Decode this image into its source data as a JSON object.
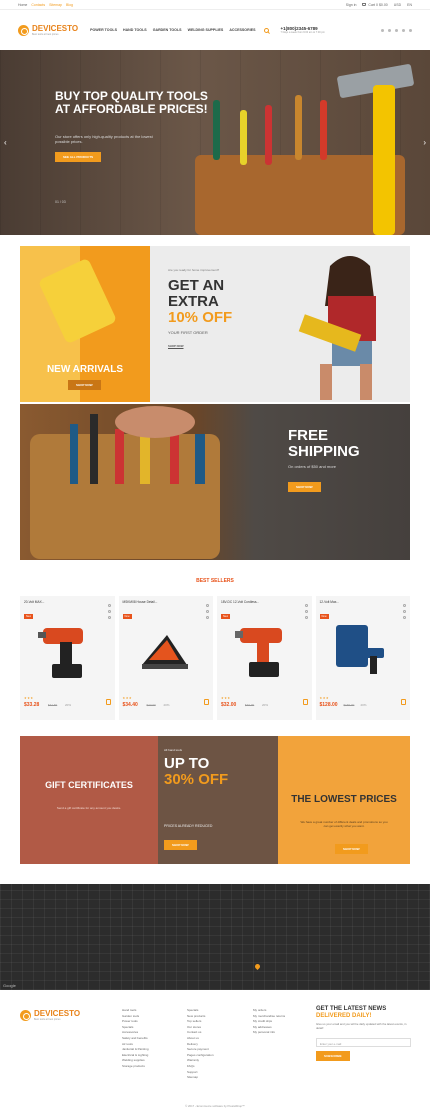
{
  "topbar": {
    "links": [
      "Home",
      "Contacts",
      "Sitemap",
      "Blog"
    ],
    "sign_in": "Sign in",
    "cart": "Cart",
    "cart_count": "0",
    "cart_total": "$0.00",
    "currency": "USD",
    "language": "EN"
  },
  "header": {
    "brand": "DEVICESTO",
    "tagline": "Best tools at best prices",
    "nav": [
      "POWER TOOLS",
      "HAND TOOLS",
      "GARDEN TOOLS",
      "WELDING SUPPLIES",
      "ACCESSORIES"
    ],
    "phone": "+1(800)2345-6789",
    "hours": "7 Days a week from 9:00 am to 7:00 pm"
  },
  "hero": {
    "title": "BUY TOP QUALITY TOOLS AT AFFORDABLE PRICES!",
    "subtitle": "Our store offers only high-quality products at the lowest possible prices.",
    "button": "SEE ALL PRODUCTS",
    "pager": "01 / 03"
  },
  "banner_new_arrivals": {
    "title": "NEW ARRIVALS",
    "button": "SHOP NOW"
  },
  "banner_extra": {
    "eyebrow": "Are you ready for home improvement?",
    "line1": "GET AN",
    "line2": "EXTRA",
    "line3": "10% OFF",
    "caption": "YOUR FIRST ORDER",
    "link": "SHOP NOW"
  },
  "banner_free": {
    "line1": "FREE",
    "line2": "SHIPPING",
    "caption": "On orders of $50 and more",
    "button": "SHOP NOW"
  },
  "best_sellers": {
    "title": "BEST SELLERS",
    "products": [
      {
        "name": "20-Volt MAX...",
        "badge": "New",
        "stars": "★★★",
        "price": "$33.28",
        "old": "$41.60",
        "off": "20%"
      },
      {
        "name": "MSKM08 House Detail...",
        "badge": "New",
        "stars": "★★★",
        "price": "$34.40",
        "old": "$43.00",
        "off": "20%"
      },
      {
        "name": "18V-DC 12-Volt Cordless...",
        "badge": "New",
        "stars": "★★★",
        "price": "$32.00",
        "old": "$40.00",
        "off": "20%"
      },
      {
        "name": "12-Volt Max...",
        "badge": "New",
        "stars": "★★★",
        "price": "$128.00",
        "old": "$160.00",
        "off": "20%"
      }
    ]
  },
  "promo": {
    "gift": {
      "title": "GIFT CERTIFICATES",
      "desc": "Send a gift certificate for any amount you desire."
    },
    "upto": {
      "eyebrow": "All hand tools",
      "line1": "UP TO",
      "line2": "30% OFF",
      "caption": "PRICES ALREADY REDUCED",
      "button": "SHOP NOW"
    },
    "lowest": {
      "title": "THE LOWEST PRICES",
      "desc": "We have a great number of different deals and promotions so you can get exactly what you want.",
      "button": "SHOP NOW"
    }
  },
  "map": {
    "google": "Google"
  },
  "footer": {
    "brand": "DEVICESTO",
    "tagline": "Best tools at best prices",
    "col1": [
      "Hand tools",
      "Garden tools",
      "Power tools",
      "Specials",
      "Accessories",
      "Safety and benefits",
      "Air tools",
      "Janitorial & Painting",
      "Electrical & Lighting",
      "Welding supplies",
      "Storage products"
    ],
    "col2": [
      "Specials",
      "New products",
      "Top sellers",
      "Our stores",
      "Contact us",
      "About us",
      "Delivery",
      "Secure payment",
      "Pages configuration",
      "Warranty",
      "FAQs",
      "Support",
      "Sitemap"
    ],
    "col3": [
      "My orders",
      "My merchandise returns",
      "My credit slips",
      "My addresses",
      "My personal info"
    ],
    "news_title1": "GET THE LATEST NEWS",
    "news_title2": "DELIVERED DAILY!",
    "news_desc": "Give us your email and you will be daily updated with the latest events, in detail!",
    "email_placeholder": "Enter your e-mail",
    "subscribe": "SUBSCRIBE",
    "copyright": "© 2017 - Ecommerce software by PrestaShop™"
  },
  "colors": {
    "accent": "#f29b1d",
    "red": "#e8531b"
  }
}
